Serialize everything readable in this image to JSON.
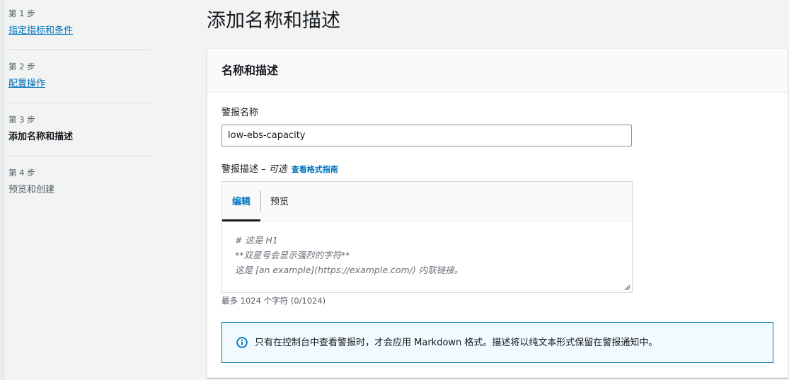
{
  "wizard": {
    "steps": [
      {
        "number": "第 1 步",
        "label": "指定指标和条件"
      },
      {
        "number": "第 2 步",
        "label": "配置操作"
      },
      {
        "number": "第 3 步",
        "label": "添加名称和描述"
      },
      {
        "number": "第 4 步",
        "label": "预览和创建"
      }
    ]
  },
  "page": {
    "title": "添加名称和描述"
  },
  "panel": {
    "title": "名称和描述",
    "alarm_name": {
      "label": "警报名称",
      "value": "low-ebs-capacity"
    },
    "alarm_description": {
      "label": "警报描述 – ",
      "optional": "可选",
      "format_guide_link": "查看格式指南",
      "tabs": [
        "编辑",
        "预览"
      ],
      "placeholder_lines": [
        "# 这是 H1",
        "**双星号会显示强烈的字符**",
        "这是 [an example](https://example.com/) 内联链接。"
      ],
      "hint": "最多 1024 个字符 (0/1024)"
    },
    "info_alert": "只有在控制台中查看警报时，才会应用 Markdown 格式。描述将以纯文本形式保留在警报通知中。"
  },
  "colors": {
    "link": "#0073bb",
    "alert_border": "#0073bb",
    "alert_bg": "#f1faff"
  },
  "icons": {
    "info": "info-circle-icon",
    "resize": "resize-handle-icon"
  }
}
